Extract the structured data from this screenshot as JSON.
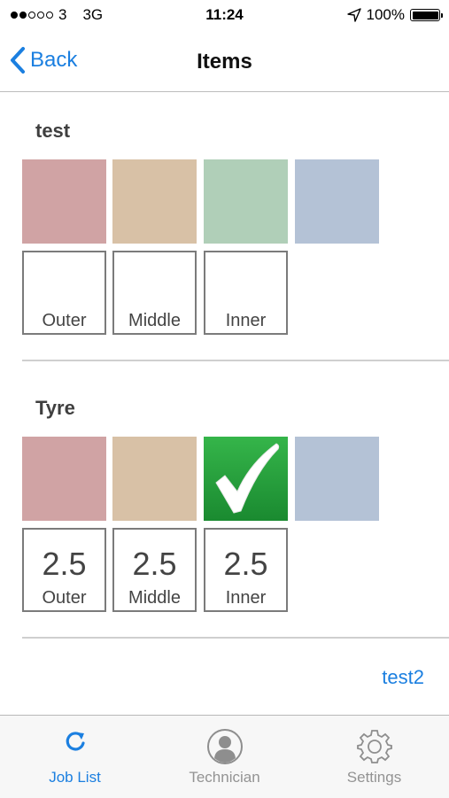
{
  "status_bar": {
    "carrier": "3",
    "network": "3G",
    "time": "11:24",
    "battery": "100%"
  },
  "nav": {
    "back_label": "Back",
    "title": "Items"
  },
  "colors": {
    "accent": "#1b7fe0",
    "swatch_red": "#d0a3a4",
    "swatch_tan": "#d8c1a6",
    "swatch_green": "#b0cfb8",
    "swatch_blue": "#b4c2d6",
    "checked_green": "#21a03a"
  },
  "sections": [
    {
      "title": "test",
      "swatch_icons": [
        "",
        "",
        "",
        ""
      ],
      "cells": [
        {
          "value": "",
          "label": "Outer"
        },
        {
          "value": "",
          "label": "Middle"
        },
        {
          "value": "",
          "label": "Inner"
        }
      ]
    },
    {
      "title": "Tyre",
      "swatch_icons": [
        "",
        "",
        "checkmark-icon",
        ""
      ],
      "cells": [
        {
          "value": "2.5",
          "label": "Outer"
        },
        {
          "value": "2.5",
          "label": "Middle"
        },
        {
          "value": "2.5",
          "label": "Inner"
        }
      ]
    }
  ],
  "next_link": "test2",
  "tab_bar": [
    {
      "label": "Job List",
      "icon": "refresh-icon",
      "active": true
    },
    {
      "label": "Technician",
      "icon": "person-icon",
      "active": false
    },
    {
      "label": "Settings",
      "icon": "gear-icon",
      "active": false
    }
  ]
}
